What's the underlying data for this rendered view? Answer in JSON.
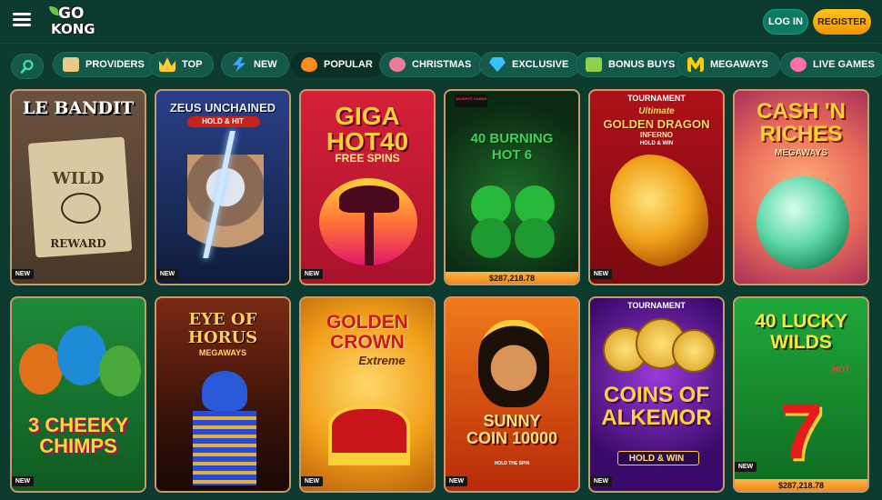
{
  "header": {
    "logo_top": "GO",
    "logo_bottom": "KONG",
    "login_label": "LOG IN",
    "register_label": "REGISTER"
  },
  "categories": [
    {
      "label": "PROVIDERS",
      "icon": "scroll-icon"
    },
    {
      "label": "TOP",
      "icon": "crown-icon"
    },
    {
      "label": "NEW",
      "icon": "lightning-icon"
    },
    {
      "label": "POPULAR",
      "icon": "fire-icon"
    },
    {
      "label": "CHRISTMAS",
      "icon": "candy-icon"
    },
    {
      "label": "EXCLUSIVE",
      "icon": "diamond-icon"
    },
    {
      "label": "BONUS BUYS",
      "icon": "gift-icon"
    },
    {
      "label": "MEGAWAYS",
      "icon": "m-icon"
    },
    {
      "label": "LIVE GAMES",
      "icon": "chips-icon"
    }
  ],
  "games": [
    {
      "title": "LE BANDIT",
      "sub1": "WILD",
      "sub2": "REWARD",
      "badge": "NEW"
    },
    {
      "title": "ZEUS UNCHAINED",
      "sub1": "HOLD & HIT",
      "badge": "NEW"
    },
    {
      "title": "GIGA HOT40",
      "sub1": "FREE SPINS",
      "badge": "NEW"
    },
    {
      "title": "40 BURNING HOT 6",
      "tag": "JACKPOT CARDS",
      "jackpot": "$287,218.78"
    },
    {
      "title": "GOLDEN DRAGON",
      "pre": "Ultimate",
      "sub1": "INFERNO",
      "sub2": "HOLD & WIN",
      "tournament": "TOURNAMENT",
      "badge": "NEW"
    },
    {
      "title": "CASH 'N RICHES",
      "sub1": "MEGAWAYS"
    },
    {
      "title": "3 CHEEKY CHIMPS",
      "badge": "NEW"
    },
    {
      "title": "EYE OF HORUS",
      "sub1": "MEGAWAYS"
    },
    {
      "title": "GOLDEN CROWN",
      "sub1": "Extreme",
      "badge": "NEW"
    },
    {
      "title": "SUNNY COIN 10000",
      "sub1": "HOLD THE SPIN",
      "badge": "NEW"
    },
    {
      "title": "COINS OF ALKEMOR",
      "sub1": "HOLD & WIN",
      "tournament": "TOURNAMENT",
      "badge": "NEW"
    },
    {
      "title": "40 LUCKY WILDS",
      "sub1": "HOT",
      "jackpot": "$287,218.78",
      "badge": "NEW"
    }
  ],
  "colors": {
    "background": "#0d3b30",
    "accent_register": "#f09500",
    "accent_login": "#0f7a63"
  }
}
